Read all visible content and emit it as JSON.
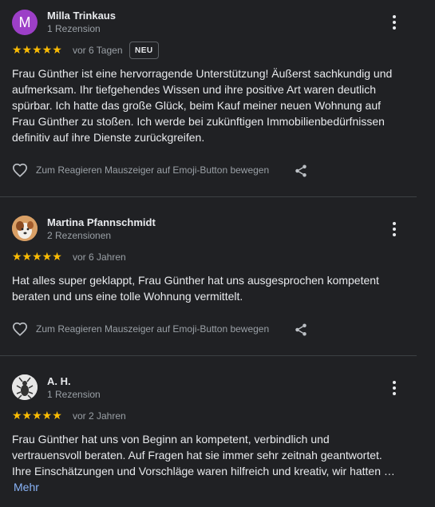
{
  "reviews": [
    {
      "author": "Milla Trinkaus",
      "avatar_letter": "M",
      "reviewer_meta": "1 Rezension",
      "stars": "★★★★★",
      "rating": 5,
      "time": "vor 6 Tagen",
      "badge": "NEU",
      "text": "Frau Günther ist eine hervorragende Unterstützung! Äußerst sachkundig und aufmerksam. Ihr tiefgehendes Wissen und ihre positive Art waren deutlich spürbar. Ich hatte das große Glück, beim Kauf meiner neuen Wohnung auf Frau Günther zu stoßen. Ich werde bei zukünftigen Immobilienbedürfnissen definitiv auf ihre Dienste zurückgreifen.",
      "react_label": "Zum Reagieren Mauszeiger auf Emoji-Button bewegen"
    },
    {
      "author": "Martina Pfannschmidt",
      "reviewer_meta": "2 Rezensionen",
      "stars": "★★★★★",
      "rating": 5,
      "time": "vor 6 Jahren",
      "text": "Hat alles super geklappt, Frau Günther hat uns ausgesprochen kompetent beraten und uns eine tolle Wohnung vermittelt.",
      "react_label": "Zum Reagieren Mauszeiger auf Emoji-Button bewegen"
    },
    {
      "author": "A. H.",
      "reviewer_meta": "1 Rezension",
      "stars": "★★★★★",
      "rating": 5,
      "time": "vor 2 Jahren",
      "text_line1": "Frau Günther hat uns von Beginn an kompetent, verbindlich und vertrauensvoll beraten. Auf Fragen hat sie immer sehr zeitnah geantwortet.",
      "text_line2": "Ihre Einschätzungen und Vorschläge waren hilfreich und kreativ, wir hatten …",
      "more_label": "Mehr"
    }
  ],
  "colors": {
    "background": "#202124",
    "star": "#fbbc04",
    "link": "#8ab4f8",
    "avatar_m": "#9c3fc7"
  }
}
